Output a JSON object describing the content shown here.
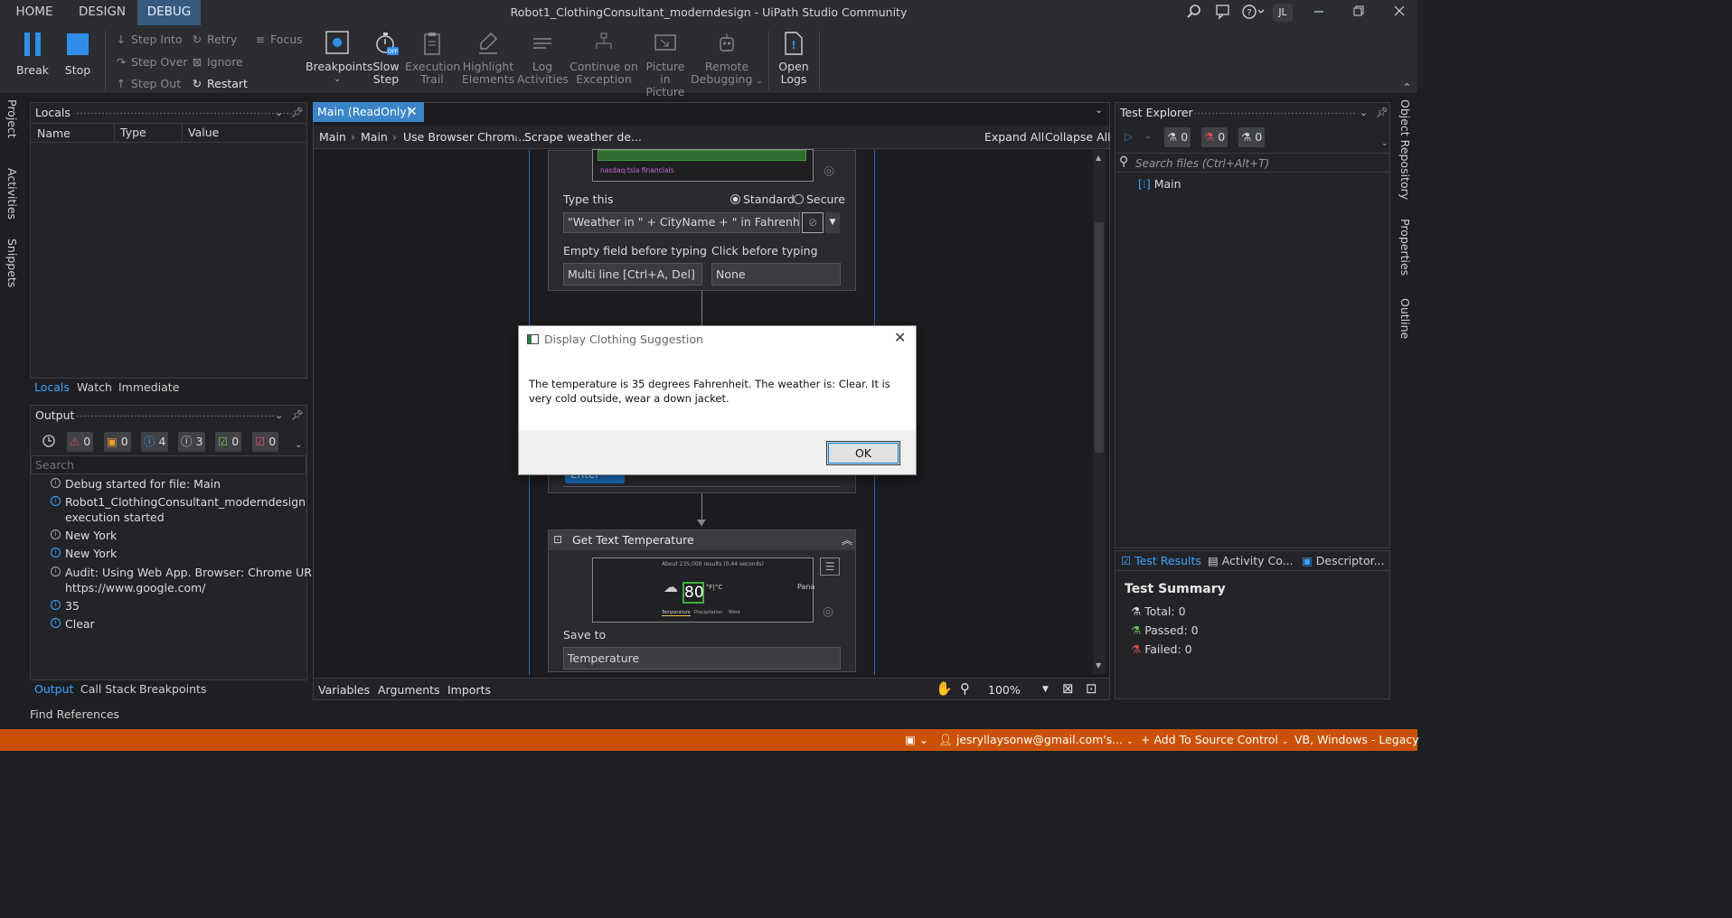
{
  "titlebar": {
    "tabs": [
      "HOME",
      "DESIGN",
      "DEBUG"
    ],
    "active_tab": "DEBUG",
    "window_title": "Robot1_ClothingConsultant_moderndesign - UiPath Studio Community",
    "user_initials": "JL"
  },
  "ribbon": {
    "break": "Break",
    "stop": "Stop",
    "step_into": "Step Into",
    "step_over": "Step Over",
    "step_out": "Step Out",
    "retry": "Retry",
    "ignore": "Ignore",
    "restart": "Restart",
    "focus": "Focus",
    "breakpoints": "Breakpoints",
    "slow_step_1": "Slow",
    "slow_step_2": "Step",
    "slow_step_badge": "OFF",
    "execution_trail_1": "Execution",
    "execution_trail_2": "Trail",
    "highlight_1": "Highlight",
    "highlight_2": "Elements",
    "log_1": "Log",
    "log_2": "Activities",
    "continue_1": "Continue on",
    "continue_2": "Exception",
    "pip_1": "Picture in",
    "pip_2": "Picture",
    "remote_1": "Remote",
    "remote_2": "Debugging",
    "open_logs_1": "Open",
    "open_logs_2": "Logs"
  },
  "left_strip": {
    "project": "Project",
    "activities": "Activities",
    "snippets": "Snippets"
  },
  "locals": {
    "title": "Locals",
    "columns": [
      "Name",
      "Type",
      "Value"
    ],
    "tabs": [
      "Locals",
      "Watch",
      "Immediate"
    ],
    "active_tab": "Locals"
  },
  "output": {
    "title": "Output",
    "filters": [
      {
        "icon": "warning-triangle-icon",
        "count": "0",
        "color": "#e04a4a"
      },
      {
        "icon": "error-square-icon",
        "count": "0",
        "color": "#f0a030"
      },
      {
        "icon": "info-icon",
        "count": "4",
        "color": "#3ea2ff"
      },
      {
        "icon": "trace-icon",
        "count": "3",
        "color": "#d0d0d0"
      },
      {
        "icon": "success-check-icon",
        "count": "0",
        "color": "#6cc04a"
      },
      {
        "icon": "failure-check-icon",
        "count": "0",
        "color": "#e04a6a"
      }
    ],
    "search_placeholder": "Search",
    "lines": [
      "Debug started for file: Main",
      "Robot1_ClothingConsultant_moderndesign execution started",
      "New York",
      "New York",
      "Audit: Using Web App. Browser: Chrome URL: https://www.google.com/",
      "35",
      "Clear"
    ],
    "tabs": [
      "Output",
      "Call Stack",
      "Breakpoints"
    ],
    "active_tab": "Output",
    "find_references": "Find References"
  },
  "designer": {
    "tab_title": "Main (ReadOnly)",
    "breadcrumb": [
      "Main",
      "Main",
      "Use Browser Chrom...",
      "Scrape weather de..."
    ],
    "expand_all": "Expand All",
    "collapse_all": "Collapse All",
    "thumb_caption": "nasdaq:tsla financials",
    "type_this_label": "Type this",
    "standard_label": "Standard",
    "secure_label": "Secure",
    "type_this_value": "\"Weather in \" + CityName + \" in Fahrenheit\"",
    "empty_field_label": "Empty field before typing",
    "empty_field_value": "Multi line [Ctrl+A, Del]",
    "click_before_label": "Click before typing",
    "click_before_value": "None",
    "enter_chip": "Enter",
    "get_text_title": "Get Text Temperature",
    "preview_temp": "80",
    "preview_unit": "°F|°C",
    "preview_side": "Pana",
    "preview_results": "About 235,000 results (0.44 seconds)",
    "preview_tabs": [
      "Temperature",
      "Precipitation",
      "Wind"
    ],
    "save_to_label": "Save to",
    "save_to_value": "Temperature",
    "bottom_tabs": [
      "Variables",
      "Arguments",
      "Imports"
    ],
    "zoom": "100%"
  },
  "dialog": {
    "title": "Display Clothing Suggestion",
    "message": "The temperature is 35 degrees Fahrenheit. The weather is: Clear. It is very cold outside, wear a down jacket.",
    "ok": "OK"
  },
  "test_explorer": {
    "title": "Test Explorer",
    "counters": [
      "0",
      "0",
      "0"
    ],
    "search_placeholder": "Search files (Ctrl+Alt+T)",
    "tree_item": "Main",
    "tabs": [
      "Test Results",
      "Activity Co...",
      "Descriptor..."
    ],
    "active_tab": "Test Results",
    "summary_title": "Test Summary",
    "total": "Total: 0",
    "passed": "Passed: 0",
    "failed": "Failed: 0"
  },
  "right_strip": {
    "object_repository": "Object Repository",
    "properties": "Properties",
    "outline": "Outline"
  },
  "statusbar": {
    "account": "jesryllaysonw@gmail.com's...",
    "source_control": "Add To Source Control",
    "language": "VB, Windows - Legacy"
  }
}
